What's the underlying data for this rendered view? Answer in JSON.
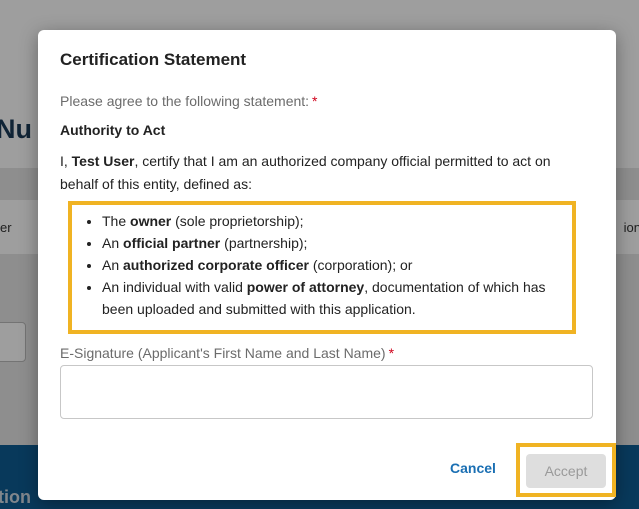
{
  "background": {
    "page_title_fragment": "Nu",
    "col_left_fragment": "er",
    "col_right_fragment": "ion",
    "footer_fragment": "tion"
  },
  "modal": {
    "title": "Certification Statement",
    "prompt": "Please agree to the following statement:",
    "required_mark": "*",
    "section_title": "Authority to Act",
    "cert_intro_prefix": "I, ",
    "user_name": "Test User",
    "cert_intro_suffix": ", certify that I am an authorized company official permitted to act on behalf of this entity, defined as:",
    "definitions": [
      {
        "pre": "The ",
        "bold": "owner",
        "post": " (sole proprietorship);"
      },
      {
        "pre": "An ",
        "bold": "official partner",
        "post": " (partnership);"
      },
      {
        "pre": "An ",
        "bold": "authorized corporate officer",
        "post": " (corporation); or"
      },
      {
        "pre": "An individual with valid ",
        "bold": "power of attorney",
        "post": ", documentation of which has been uploaded and submitted with this application."
      }
    ],
    "esignature": {
      "label": "E-Signature (Applicant's First Name and Last Name)",
      "value": "",
      "placeholder": ""
    },
    "buttons": {
      "cancel": "Cancel",
      "accept": "Accept"
    }
  },
  "colors": {
    "highlight": "#f0b323",
    "link_blue": "#1a6fb3",
    "required_red": "#d0021b",
    "footer_blue": "#0d5d94"
  }
}
